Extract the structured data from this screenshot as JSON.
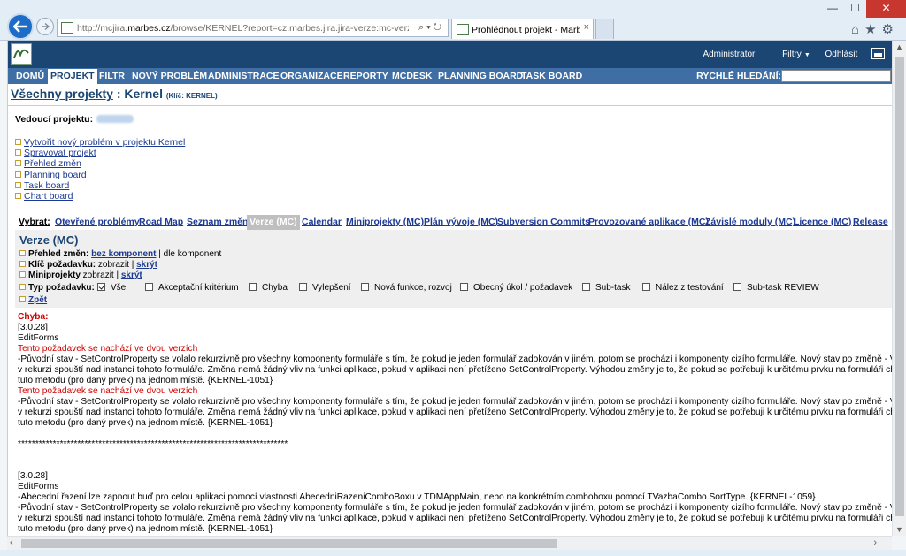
{
  "browser": {
    "url_prefix": "http://mcjira.",
    "url_domain": "marbes.cz",
    "url_rest": "/browse/KERNEL?report=cz.marbes.jira.jira-verze:mc-verzi-panel&",
    "tab_title": "Prohlédnout projekt - Marb...",
    "tab_close": "×",
    "min_glyph": "—",
    "max_glyph": "☐",
    "close_glyph": "✕",
    "toolbar_icons": "⌂★⚙"
  },
  "header": {
    "user": "Administrator",
    "filters": "Filtry",
    "logout": "Odhlásit"
  },
  "menu": {
    "items": [
      "DOMŮ",
      "PROJEKT",
      "FILTR",
      "NOVÝ PROBLÉM",
      "ADMINISTRACE",
      "ORGANIZACE",
      "REPORTY",
      "MCDESK",
      "PLANNING BOARD",
      "TASK BOARD"
    ],
    "quick_search_label": "RYCHLÉ HLEDÁNÍ:"
  },
  "project": {
    "all_projects": "Všechny projekty",
    "separator": " : ",
    "name": "Kernel",
    "key_note": "(Klíč: KERNEL)",
    "lead_label": "Vedoucí projektu:"
  },
  "project_links": [
    "Vytvořit nový problém v projektu Kernel",
    "Spravovat projekt",
    "Přehled změn",
    "Planning board",
    "Task board",
    "Chart board"
  ],
  "tabs": {
    "label": "Vybrat:",
    "items": [
      "Otevřené problémy",
      "Road Map",
      "Seznam změn",
      "Verze (MC)",
      "Calendar",
      "Miniprojekty (MC)",
      "Plán vývoje (MC)",
      "Subversion Commits",
      "Provozované aplikace (MC)",
      "Závislé moduly (MC)",
      "Licence (MC)",
      "Release"
    ],
    "selected": "Verze (MC)"
  },
  "panel": {
    "title": "Verze (MC)",
    "overview_label": "Přehled změn:",
    "overview_link": "bez komponent",
    "overview_rest": " | dle komponent",
    "key_label": "Klíč požadavku:",
    "key_show": " zobrazit | ",
    "key_hide": "skrýt",
    "mini_label": "Miniprojekty",
    "mini_show": " zobrazit | ",
    "mini_hide": "skrýt",
    "type_label": "Typ požadavku:",
    "types": [
      {
        "label": "Vše",
        "checked": true
      },
      {
        "label": "Akceptační kritérium",
        "checked": false
      },
      {
        "label": "Chyba",
        "checked": false
      },
      {
        "label": "Vylepšení",
        "checked": false
      },
      {
        "label": "Nová funkce, rozvoj",
        "checked": false
      },
      {
        "label": "Obecný úkol / požadavek",
        "checked": false
      },
      {
        "label": "Sub-task",
        "checked": false
      },
      {
        "label": "Nález z testování",
        "checked": false
      },
      {
        "label": "Sub-task REVIEW",
        "checked": false
      }
    ],
    "back": "Zpět"
  },
  "report": {
    "category": "Chyba:",
    "v1": "[3.0.28]",
    "edit1": "EditForms",
    "warn1": "  Tento požadavek se nachází ve dvou verzích",
    "p1a": "  -Původní stav - SetControlProperty se volalo rekurzivně pro všechny komponenty formuláře s tím, že pokud je jeden formulář zadokován v jiném, potom se prochází i komponenty cizího formuláře. Nový stav po změně - V případě",
    "p1b": "v rekurzi spouští nad instancí tohoto formuláře. Změna nemá žádný vliv na funkci aplikace, pokud v aplikaci není přetíženo SetControlProperty. Výhodou změny je to, že pokud se potřebuji k určitému prvku na formuláři chovat jinak",
    "p1c": "tuto metodu (pro daný prvek) na jednom místě. {KERNEL-1051}",
    "warn2": "  Tento požadavek se nachází ve dvou verzích",
    "p2a": "  -Původní stav - SetControlProperty se volalo rekurzivně pro všechny komponenty formuláře s tím, že pokud je jeden formulář zadokován v jiném, potom se prochází i komponenty cizího formuláře. Nový stav po změně - V případě",
    "p2b": "v rekurzi spouští nad instancí tohoto formuláře. Změna nemá žádný vliv na funkci aplikace, pokud v aplikaci není přetíženo SetControlProperty. Výhodou změny je to, že pokud se potřebuji k určitému prvku na formuláři chovat jinak",
    "p2c": "tuto metodu (pro daný prvek) na jednom místě. {KERNEL-1051}",
    "stars": "*****************************************************************************",
    "v2": "[3.0.28]",
    "edit2": "EditForms",
    "p3": "  -Abecední řazení lze zapnout buď pro celou aplikaci pomocí vlastnosti AbecedniRazeniComboBoxu v TDMAppMain, nebo na konkrétním comboboxu pomocí TVazbaCombo.SortType. {KERNEL-1059}",
    "p4a": "  -Původní stav - SetControlProperty se volalo rekurzivně pro všechny komponenty formuláře s tím, že pokud je jeden formulář zadokován v jiném, potom se prochází i komponenty cizího formuláře. Nový stav po změně - V případě",
    "p4b": "v rekurzi spouští nad instancí tohoto formuláře. Změna nemá žádný vliv na funkci aplikace, pokud v aplikaci není přetíženo SetControlProperty. Výhodou změny je to, že pokud se potřebuji k určitému prvku na formuláři chovat jinak",
    "p4c": "tuto metodu (pro daný prvek) na jednom místě. {KERNEL-1051}"
  },
  "colors": {
    "header": "#1b4572",
    "menubar": "#3e6ea3",
    "link": "#1d3a92",
    "warning": "#d40000"
  }
}
